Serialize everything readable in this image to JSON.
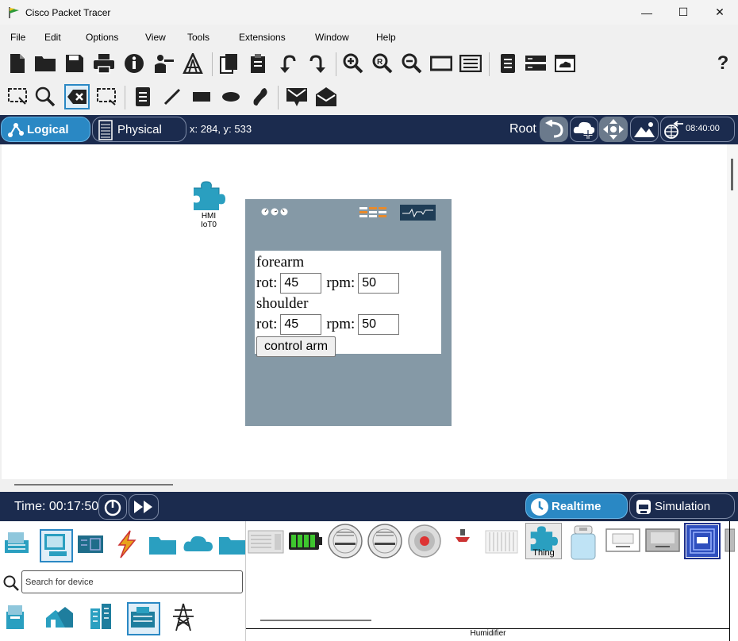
{
  "window": {
    "title": "Cisco Packet Tracer",
    "minimize": "—",
    "maximize": "☐",
    "close": "✕"
  },
  "menu": [
    "File",
    "Edit",
    "Options",
    "View",
    "Tools",
    "Extensions",
    "Window",
    "Help"
  ],
  "modebar": {
    "logical_label": "Logical",
    "physical_label": "Physical",
    "coords": "x: 284, y: 533",
    "root_label": "Root",
    "clock": "08:40:00"
  },
  "device": {
    "name_line1": "HMI",
    "name_line2": "IoT0"
  },
  "panel": {
    "forearm_label": "forearm",
    "forearm_rot_label": "rot:",
    "forearm_rot_value": "45",
    "forearm_rpm_label": "rpm:",
    "forearm_rpm_value": "50",
    "shoulder_label": "shoulder",
    "shoulder_rot_label": "rot:",
    "shoulder_rot_value": "45",
    "shoulder_rpm_label": "rpm:",
    "shoulder_rpm_value": "50",
    "button_label": "control arm"
  },
  "timebar": {
    "time": "Time: 00:17:50",
    "realtime_label": "Realtime",
    "simulation_label": "Simulation"
  },
  "device_picker": {
    "search_placeholder": "Search for device",
    "thing_label": "Thing",
    "selected_device_label": "Humidifier"
  },
  "colors": {
    "navy": "#1b2b4e",
    "accent_blue": "#2a88c4",
    "panel_gray": "#8599a6"
  }
}
